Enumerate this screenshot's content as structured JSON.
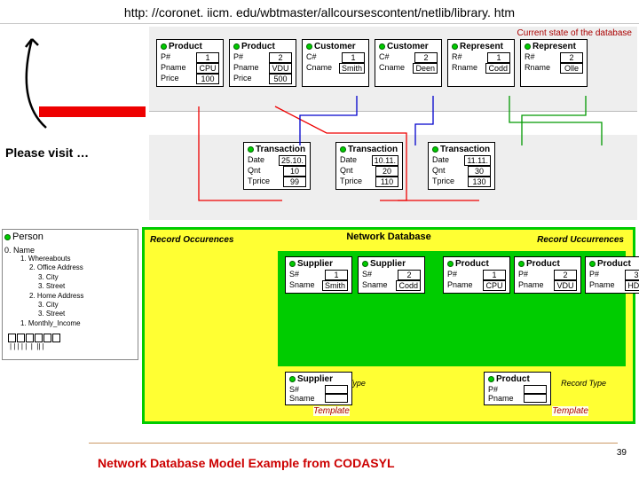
{
  "url": "http: //coronet. iicm. edu/wbtmaster/allcoursescontent/netlib/library. htm",
  "visit": "Please visit …",
  "state_label": "Current state of the database",
  "top_cards": [
    {
      "title": "Product",
      "rows": [
        {
          "k": "P#",
          "v": "1"
        },
        {
          "k": "Pname",
          "v": "CPU"
        },
        {
          "k": "Price",
          "v": "100"
        }
      ]
    },
    {
      "title": "Product",
      "rows": [
        {
          "k": "P#",
          "v": "2"
        },
        {
          "k": "Pname",
          "v": "VDU"
        },
        {
          "k": "Price",
          "v": "500"
        }
      ]
    },
    {
      "title": "Customer",
      "rows": [
        {
          "k": "C#",
          "v": "1"
        },
        {
          "k": "Cname",
          "v": "Smith"
        }
      ]
    },
    {
      "title": "Customer",
      "rows": [
        {
          "k": "C#",
          "v": "2"
        },
        {
          "k": "Cname",
          "v": "Deen"
        }
      ]
    },
    {
      "title": "Represent",
      "rows": [
        {
          "k": "R#",
          "v": "1"
        },
        {
          "k": "Rname",
          "v": "Codd"
        }
      ]
    },
    {
      "title": "Represent",
      "rows": [
        {
          "k": "R#",
          "v": "2"
        },
        {
          "k": "Rname",
          "v": "Olle"
        }
      ]
    }
  ],
  "mid_cards": [
    {
      "title": "Transaction",
      "rows": [
        {
          "k": "Date",
          "v": "25.10."
        },
        {
          "k": "Qnt",
          "v": "10"
        },
        {
          "k": "Tprice",
          "v": "99"
        }
      ]
    },
    {
      "title": "Transaction",
      "rows": [
        {
          "k": "Date",
          "v": "10.11."
        },
        {
          "k": "Qnt",
          "v": "20"
        },
        {
          "k": "Tprice",
          "v": "110"
        }
      ]
    },
    {
      "title": "Transaction",
      "rows": [
        {
          "k": "Date",
          "v": "11.11."
        },
        {
          "k": "Qnt",
          "v": "30"
        },
        {
          "k": "Tprice",
          "v": "130"
        }
      ]
    }
  ],
  "netdb": {
    "title": "Network Database",
    "rec_occ_left": "Record Occurences",
    "rec_occ_right": "Record Uccurrences",
    "record_type": "Record Type",
    "template": "Template",
    "suppliers": [
      {
        "title": "Supplier",
        "rows": [
          {
            "k": "S#",
            "v": "1"
          },
          {
            "k": "Sname",
            "v": "Smith"
          }
        ]
      },
      {
        "title": "Supplier",
        "rows": [
          {
            "k": "S#",
            "v": "2"
          },
          {
            "k": "Sname",
            "v": "Codd"
          }
        ]
      }
    ],
    "products": [
      {
        "title": "Product",
        "rows": [
          {
            "k": "P#",
            "v": "1"
          },
          {
            "k": "Pname",
            "v": "CPU"
          }
        ]
      },
      {
        "title": "Product",
        "rows": [
          {
            "k": "P#",
            "v": "2"
          },
          {
            "k": "Pname",
            "v": "VDU"
          }
        ]
      },
      {
        "title": "Product",
        "rows": [
          {
            "k": "P#",
            "v": "3"
          },
          {
            "k": "Pname",
            "v": "HDD"
          }
        ]
      }
    ],
    "supplier_template": {
      "title": "Supplier",
      "rows": [
        {
          "k": "S#",
          "v": ""
        },
        {
          "k": "Sname",
          "v": ""
        }
      ]
    },
    "product_template": {
      "title": "Product",
      "rows": [
        {
          "k": "P#",
          "v": ""
        },
        {
          "k": "Pname",
          "v": ""
        }
      ]
    }
  },
  "person": {
    "title": "Person",
    "root": "0. Name",
    "items": [
      "1. Whereabouts",
      "2. Office Address",
      "3. City",
      "3. Street",
      "2. Home Address",
      "3. City",
      "3. Street",
      "1. Monthly_Income"
    ]
  },
  "caption": "Network Database Model Example from CODASYL",
  "page": "39"
}
